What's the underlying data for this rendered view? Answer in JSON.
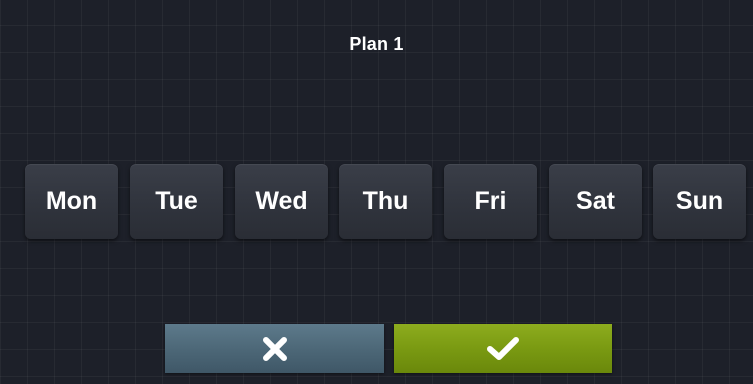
{
  "header": {
    "title": "Plan 1"
  },
  "days": [
    {
      "label": "Mon"
    },
    {
      "label": "Tue"
    },
    {
      "label": "Wed"
    },
    {
      "label": "Thu"
    },
    {
      "label": "Fri"
    },
    {
      "label": "Sat"
    },
    {
      "label": "Sun"
    }
  ],
  "actions": {
    "cancel_icon": "close-icon",
    "confirm_icon": "checkmark-icon"
  },
  "colors": {
    "background": "#1d2029",
    "day_button": "#30343d",
    "cancel_button": "#4d6878",
    "confirm_button": "#7a9a12",
    "text": "#ffffff"
  }
}
